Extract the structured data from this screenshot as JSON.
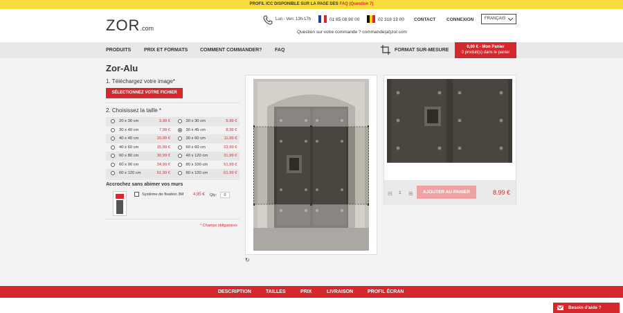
{
  "topbar": {
    "text": "PROFIL ICC DISPONIBLE SUR LA PAGE DES ",
    "faq": "FAQ (Question 7)"
  },
  "header": {
    "logo_main": "ZOR",
    "logo_sub": ".com",
    "hours": "Lun - Ven: 13h-17h",
    "phone_fr": "01 85 08 90 00",
    "phone_be": "02 318 19 00",
    "question": "Question sur votre commande ? commande(at)zor.com",
    "contact": "CONTACT",
    "login": "CONNEXION",
    "language": "FRANÇAIS"
  },
  "nav": {
    "products": "PRODUITS",
    "prices": "PRIX ET FORMATS",
    "how": "COMMENT COMMANDER?",
    "faq": "FAQ",
    "custom": "FORMAT SUR-MESURE",
    "cart_total": "0,00 € - Mon Panier",
    "cart_count": "0 produit(s) dans le panier"
  },
  "product": {
    "title": "Zor-Alu",
    "step1": "1. Téléchargez votre image*",
    "upload_button": "SÉLECTIONNEZ VOTRE FICHIER",
    "step2": "2. Choisissez la taille *",
    "sizes": [
      [
        {
          "label": "20 x 30 cm",
          "price": "3,99 €"
        },
        {
          "label": "30 x 30 cm",
          "price": "5,99 €"
        }
      ],
      [
        {
          "label": "30 x 40 cm",
          "price": "7,99 €"
        },
        {
          "label": "30 x 45 cm",
          "price": "8,99 €"
        }
      ],
      [
        {
          "label": "40 x 40 cm",
          "price": "10,99 €"
        },
        {
          "label": "30 x 60 cm",
          "price": "11,99 €"
        }
      ],
      [
        {
          "label": "40 x 60 cm",
          "price": "15,99 €"
        },
        {
          "label": "60 x 60 cm",
          "price": "23,99 €"
        }
      ],
      [
        {
          "label": "60 x 80 cm",
          "price": "30,99 €"
        },
        {
          "label": "40 x 120 cm",
          "price": "31,99 €"
        }
      ],
      [
        {
          "label": "60 x 90 cm",
          "price": "34,99 €"
        },
        {
          "label": "80 x 100 cm",
          "price": "51,99 €"
        }
      ],
      [
        {
          "label": "60 x 120 cm",
          "price": "51,99 €"
        },
        {
          "label": "80 x 120 cm",
          "price": "61,99 €"
        }
      ]
    ],
    "selected_size": "30 x 45 cm",
    "hang_title": "Accrochez sans abimer vos murs",
    "accessory_label": "Système de fixation 3M",
    "accessory_price": "4,95 €",
    "qty_label": "Qty:",
    "qty_value": "0",
    "required_note": "* Champs obligatoires"
  },
  "preview": {
    "qty_minus": "⊟",
    "qty": "1",
    "qty_plus": "⊞",
    "add_button": "AJOUTER AU PANIER",
    "total": "8.99 €"
  },
  "tabs": [
    "DESCRIPTION",
    "TAILLES",
    "PRIX",
    "LIVRAISON",
    "PROFIL ÉCRAN"
  ],
  "help": "Besoin d'aide ?"
}
